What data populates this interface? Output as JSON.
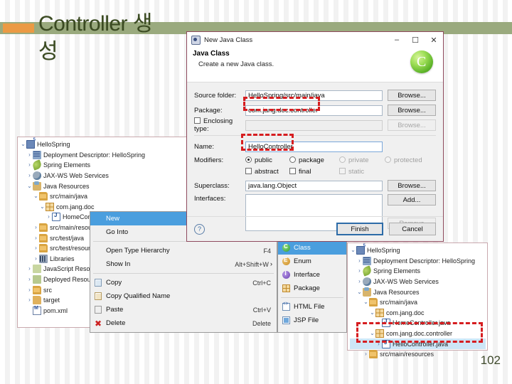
{
  "slide": {
    "title": "Controller 생\n성",
    "page_number": "102",
    "accent_band_color": "#9aaa7e",
    "marker_color": "#eb9a44",
    "highlight_color": "#d61d20"
  },
  "left_tree": {
    "nodes": [
      {
        "arrow": "v",
        "indent": 0,
        "icon": "project-icon",
        "label": "HelloSpring"
      },
      {
        "arrow": ">",
        "indent": 1,
        "icon": "deployment-descriptor-icon",
        "label": "Deployment Descriptor: HelloSpring"
      },
      {
        "arrow": ">",
        "indent": 1,
        "icon": "spring-leaf-icon",
        "label": "Spring Elements"
      },
      {
        "arrow": ">",
        "indent": 1,
        "icon": "web-services-icon",
        "label": "JAX-WS Web Services"
      },
      {
        "arrow": "v",
        "indent": 1,
        "icon": "java-resources-icon",
        "label": "Java Resources"
      },
      {
        "arrow": "v",
        "indent": 2,
        "icon": "source-folder-icon",
        "label": "src/main/java"
      },
      {
        "arrow": "v",
        "indent": 3,
        "icon": "package-icon",
        "label": "com.jang.doc"
      },
      {
        "arrow": ">",
        "indent": 4,
        "icon": "java-file-icon",
        "label": "HomeController.java"
      },
      {
        "arrow": ">",
        "indent": 2,
        "icon": "source-folder-icon",
        "label": "src/main/resources"
      },
      {
        "arrow": ">",
        "indent": 2,
        "icon": "source-folder-icon",
        "label": "src/test/java"
      },
      {
        "arrow": ">",
        "indent": 2,
        "icon": "source-folder-icon",
        "label": "src/test/resources"
      },
      {
        "arrow": ">",
        "indent": 2,
        "icon": "libraries-icon",
        "label": "Libraries"
      },
      {
        "arrow": ">",
        "indent": 1,
        "icon": "javascript-resources-icon",
        "label": "JavaScript Resources"
      },
      {
        "arrow": ">",
        "indent": 1,
        "icon": "deployed-resources-icon",
        "label": "Deployed Resources"
      },
      {
        "arrow": ">",
        "indent": 1,
        "icon": "src-folder-icon",
        "label": "src"
      },
      {
        "arrow": ">",
        "indent": 1,
        "icon": "target-folder-icon",
        "label": "target"
      },
      {
        "arrow": "",
        "indent": 1,
        "icon": "pom-file-icon",
        "label": "pom.xml"
      }
    ]
  },
  "context_menu": {
    "items": [
      {
        "label": "New",
        "shortcut": "",
        "icon": "",
        "highlighted": true,
        "submenu_arrow": ""
      },
      {
        "label": "Go Into",
        "shortcut": "",
        "icon": "",
        "highlighted": false,
        "submenu_arrow": ""
      },
      {
        "separator": true
      },
      {
        "label": "Open Type Hierarchy",
        "shortcut": "F4",
        "icon": "",
        "highlighted": false,
        "submenu_arrow": ""
      },
      {
        "label": "Show In",
        "shortcut": "Alt+Shift+W",
        "icon": "",
        "highlighted": false,
        "submenu_arrow": ">"
      },
      {
        "separator": true
      },
      {
        "label": "Copy",
        "shortcut": "Ctrl+C",
        "icon": "copy-icon",
        "highlighted": false,
        "submenu_arrow": ""
      },
      {
        "label": "Copy Qualified Name",
        "shortcut": "",
        "icon": "copy-qualified-icon",
        "highlighted": false,
        "submenu_arrow": ""
      },
      {
        "label": "Paste",
        "shortcut": "Ctrl+V",
        "icon": "paste-icon",
        "highlighted": false,
        "submenu_arrow": ""
      },
      {
        "label": "Delete",
        "shortcut": "Delete",
        "icon": "delete-icon",
        "highlighted": false,
        "submenu_arrow": ""
      }
    ]
  },
  "submenu": {
    "items": [
      {
        "label": "Class",
        "icon": "class-icon",
        "highlighted": true
      },
      {
        "label": "Enum",
        "icon": "enum-icon",
        "highlighted": false
      },
      {
        "label": "Interface",
        "icon": "interface-icon",
        "highlighted": false
      },
      {
        "label": "Package",
        "icon": "package-icon",
        "highlighted": false
      },
      {
        "separator": true
      },
      {
        "label": "HTML File",
        "icon": "html-file-icon",
        "highlighted": false
      },
      {
        "label": "JSP File",
        "icon": "jsp-file-icon",
        "highlighted": false
      }
    ]
  },
  "dialog": {
    "window_title": "New Java Class",
    "window_buttons": {
      "minimize": "–",
      "maximize": "☐",
      "close": "✕"
    },
    "heading": "Java Class",
    "subheading": "Create a new Java class.",
    "fields": {
      "source_folder_label": "Source folder:",
      "source_folder_value": "HelloSpring/src/main/java",
      "source_folder_browse": "Browse...",
      "package_label": "Package:",
      "package_value": "com.jang.doc.controller",
      "package_browse": "Browse...",
      "enclosing_type_label": "Enclosing type:",
      "enclosing_type_value": "",
      "enclosing_type_browse": "Browse...",
      "name_label": "Name:",
      "name_value": "HelloController",
      "modifiers_label": "Modifiers:",
      "modifier_public": "public",
      "modifier_package": "package",
      "modifier_private": "private",
      "modifier_protected": "protected",
      "modifier_abstract": "abstract",
      "modifier_final": "final",
      "modifier_static": "static",
      "superclass_label": "Superclass:",
      "superclass_value": "java.lang.Object",
      "superclass_browse": "Browse...",
      "interfaces_label": "Interfaces:",
      "interfaces_add": "Add...",
      "interfaces_remove": "Remove"
    },
    "footer": {
      "help": "?",
      "finish": "Finish",
      "cancel": "Cancel"
    }
  },
  "right_tree": {
    "nodes": [
      {
        "arrow": "v",
        "indent": 0,
        "icon": "project-icon",
        "label": "HelloSpring",
        "selected": false
      },
      {
        "arrow": ">",
        "indent": 1,
        "icon": "deployment-descriptor-icon",
        "label": "Deployment Descriptor: HelloSpring",
        "selected": false
      },
      {
        "arrow": ">",
        "indent": 1,
        "icon": "spring-leaf-icon",
        "label": "Spring Elements",
        "selected": false
      },
      {
        "arrow": ">",
        "indent": 1,
        "icon": "web-services-icon",
        "label": "JAX-WS Web Services",
        "selected": false
      },
      {
        "arrow": "v",
        "indent": 1,
        "icon": "java-resources-icon",
        "label": "Java Resources",
        "selected": false
      },
      {
        "arrow": "v",
        "indent": 2,
        "icon": "source-folder-icon",
        "label": "src/main/java",
        "selected": false
      },
      {
        "arrow": "v",
        "indent": 3,
        "icon": "package-icon",
        "label": "com.jang.doc",
        "selected": false
      },
      {
        "arrow": ">",
        "indent": 4,
        "icon": "java-file-icon",
        "label": "HomeController.java",
        "selected": false
      },
      {
        "arrow": "v",
        "indent": 3,
        "icon": "package-icon",
        "label": "com.jang.doc.controller",
        "selected": false
      },
      {
        "arrow": ">",
        "indent": 4,
        "icon": "java-file-icon",
        "label": "HelloController.java",
        "selected": true
      },
      {
        "arrow": ">",
        "indent": 2,
        "icon": "source-folder-icon",
        "label": "src/main/resources",
        "selected": false
      }
    ]
  }
}
